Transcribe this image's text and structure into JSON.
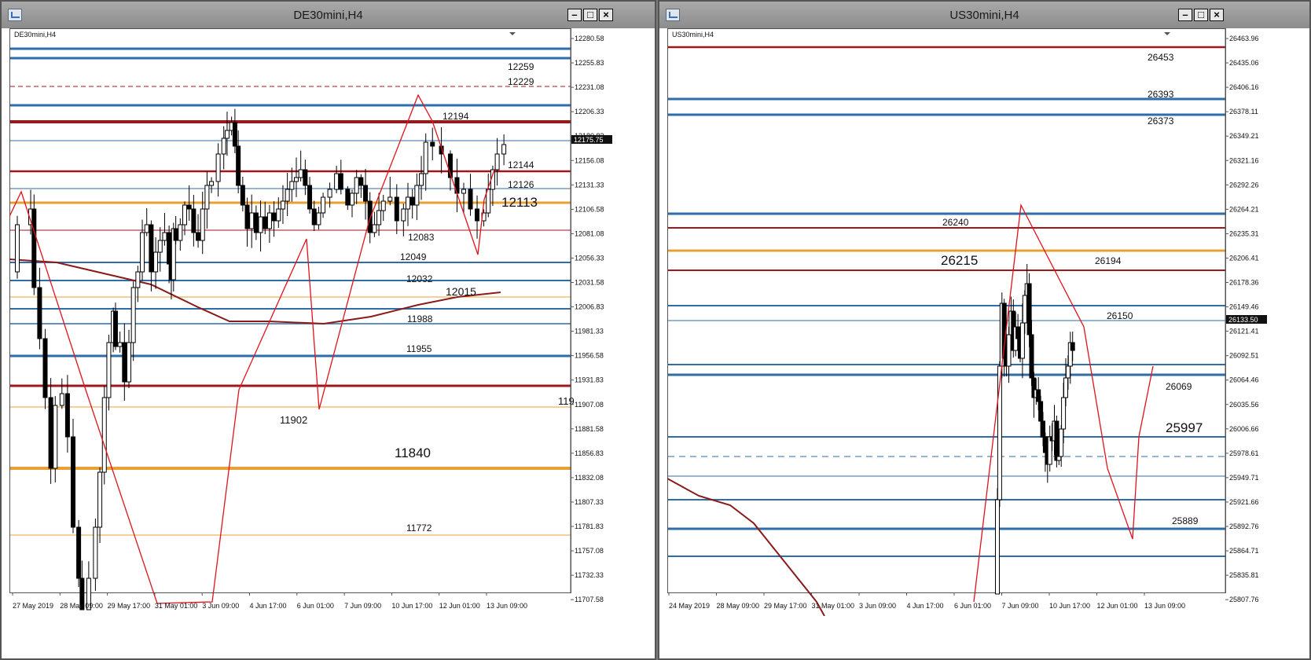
{
  "windows": [
    {
      "id": "de30",
      "title": "DE30mini,H4",
      "symbol_label": "DE30mini,H4",
      "current_price": "12175.75",
      "price_axis": [
        "12280.58",
        "12255.83",
        "12231.08",
        "12206.33",
        "12180.83",
        "12156.08",
        "12131.33",
        "12106.58",
        "12081.08",
        "12056.33",
        "12031.58",
        "12006.83",
        "11981.33",
        "11956.58",
        "11931.83",
        "11907.08",
        "11881.58",
        "11856.83",
        "11832.08",
        "11807.33",
        "11781.83",
        "11757.08",
        "11732.33",
        "11707.58"
      ],
      "time_axis": [
        "27 May 2019",
        "28 May 09:00",
        "29 May 17:00",
        "31 May 01:00",
        "3 Jun 09:00",
        "4 Jun 17:00",
        "6 Jun 01:00",
        "7 Jun 09:00",
        "10 Jun 17:00",
        "12 Jun 01:00",
        "13 Jun 09:00"
      ],
      "level_labels": [
        "12259",
        "12229",
        "12194",
        "12144",
        "12126",
        "12113",
        "12083",
        "12049",
        "12032",
        "12015",
        "11988",
        "11955",
        "11902",
        "11840",
        "11772",
        "119"
      ],
      "colors": {
        "level_blue": "#2f6da8",
        "level_red": "#a0161b",
        "level_orange": "#e8a035",
        "zigzag": "#e0131c",
        "ma": "#8b1a1a"
      }
    },
    {
      "id": "us30",
      "title": "US30mini,H4",
      "symbol_label": "US30mini,H4",
      "current_price": "26133.50",
      "price_axis": [
        "26463.96",
        "26435.06",
        "26406.16",
        "26378.11",
        "26349.21",
        "26321.16",
        "26292.26",
        "26264.21",
        "26235.31",
        "26206.41",
        "26178.36",
        "26149.46",
        "26121.41",
        "26092.51",
        "26064.46",
        "26035.56",
        "26006.66",
        "25978.61",
        "25949.71",
        "25921.66",
        "25892.76",
        "25864.71",
        "25835.81",
        "25807.76"
      ],
      "time_axis": [
        "24 May 2019",
        "28 May 09:00",
        "29 May 17:00",
        "31 May 01:00",
        "3 Jun 09:00",
        "4 Jun 17:00",
        "6 Jun 01:00",
        "7 Jun 09:00",
        "10 Jun 17:00",
        "12 Jun 01:00",
        "13 Jun 09:00"
      ],
      "level_labels": [
        "26453",
        "26393",
        "26373",
        "26240",
        "26215",
        "26194",
        "26150",
        "26069",
        "25997",
        "25889"
      ],
      "colors": {
        "level_blue": "#2f6da8",
        "level_red": "#a0161b",
        "level_orange": "#e8a035",
        "zigzag": "#e0131c",
        "ma": "#8b1a1a"
      }
    }
  ]
}
